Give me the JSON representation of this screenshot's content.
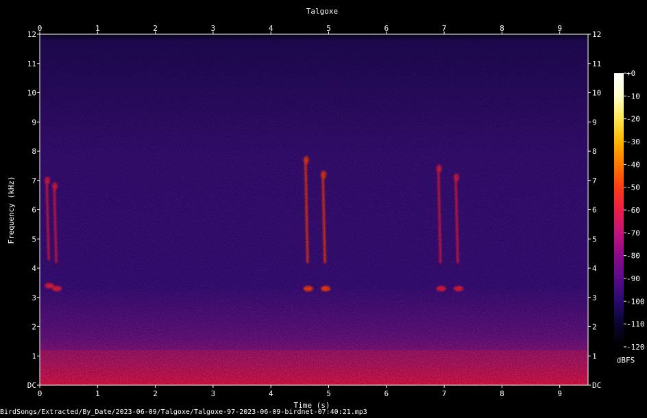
{
  "chart_data": {
    "type": "heatmap",
    "title": "Talgoxe",
    "xlabel": "Time (s)",
    "ylabel": "Frequency (kHz)",
    "xlim": [
      0,
      9.5
    ],
    "ylim": [
      0,
      12
    ],
    "x_ticks": [
      "0",
      "1",
      "2",
      "3",
      "4",
      "5",
      "6",
      "7",
      "8",
      "9"
    ],
    "y_ticks": [
      "DC",
      "1",
      "2",
      "3",
      "4",
      "5",
      "6",
      "7",
      "8",
      "9",
      "10",
      "11",
      "12"
    ],
    "colorbar": {
      "label": "dBFS",
      "ticks": [
        "+0",
        "-10",
        "-20",
        "-30",
        "-40",
        "-50",
        "-60",
        "-70",
        "-80",
        "-90",
        "-100",
        "-110",
        "-120"
      ],
      "range": [
        -120,
        0
      ],
      "colors": [
        "#000000",
        "#0a0530",
        "#280a6e",
        "#5a0a8c",
        "#8c0a8c",
        "#c0147a",
        "#eb1e46",
        "#ff3c14",
        "#ff7800",
        "#ffb400",
        "#ffe650",
        "#ffffc8",
        "#ffffff"
      ]
    },
    "background_level_dbfs": -92,
    "low_frequency_band": {
      "max_khz": 1.2,
      "level_dbfs": -62
    },
    "calls": [
      {
        "time_s": 0.12,
        "freq_khz": [
          3.4,
          7.0
        ],
        "level_dbfs": -58
      },
      {
        "time_s": 0.25,
        "freq_khz": [
          3.3,
          6.8
        ],
        "level_dbfs": -60
      },
      {
        "time_s": 4.6,
        "freq_khz": [
          3.3,
          7.7
        ],
        "level_dbfs": -55
      },
      {
        "time_s": 4.9,
        "freq_khz": [
          3.3,
          7.2
        ],
        "level_dbfs": -55
      },
      {
        "time_s": 6.9,
        "freq_khz": [
          3.3,
          7.4
        ],
        "level_dbfs": -56
      },
      {
        "time_s": 7.2,
        "freq_khz": [
          3.3,
          7.1
        ],
        "level_dbfs": -58
      }
    ]
  },
  "footer": {
    "file_path": "BirdSongs/Extracted/By_Date/2023-06-09/Talgoxe/Talgoxe-97-2023-06-09-birdnet-07:40:21.mp3"
  }
}
